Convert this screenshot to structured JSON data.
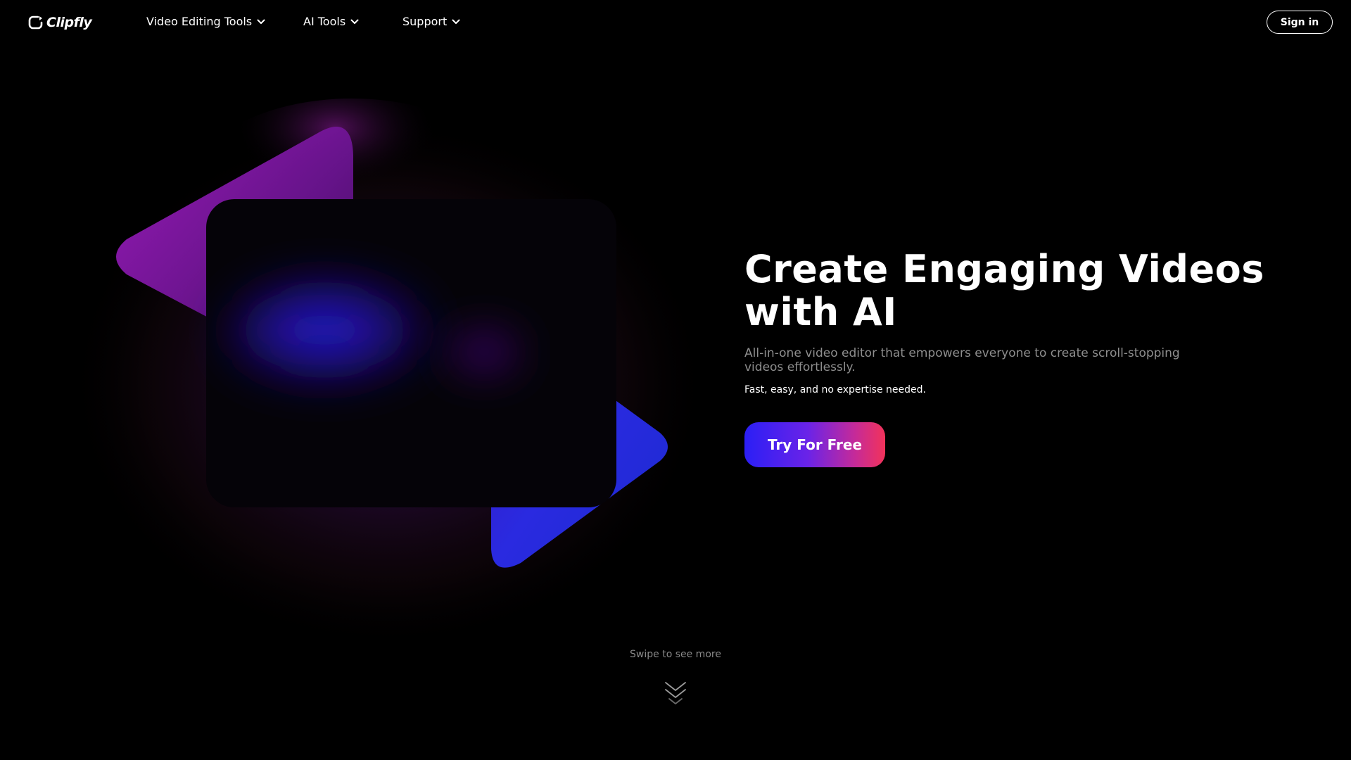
{
  "brand": {
    "logo_text": "Clipfly",
    "logo_icon": "clipfly-logo-icon"
  },
  "nav": {
    "items": [
      {
        "label": "Video Editing Tools",
        "icon": "chevron-down-icon"
      },
      {
        "label": "AI Tools",
        "icon": "chevron-down-icon"
      },
      {
        "label": "Support",
        "icon": "chevron-down-icon"
      }
    ],
    "signin_label": "Sign in"
  },
  "hero": {
    "title_line1": "Create Engaging Videos",
    "title_line2": "with AI",
    "subtitle": "All-in-one video editor that empowers everyone to create scroll-stopping videos effortlessly.",
    "note": "Fast, easy, and no expertise needed.",
    "cta_label": "Try For Free"
  },
  "scroll_hint": {
    "label": "Swipe to see more",
    "icon": "double-chevron-down-icon"
  },
  "colors": {
    "background": "#000000",
    "cta_gradient_start": "#2b1ff5",
    "cta_gradient_end": "#f2335a",
    "accent_purple": "#9b1fd0",
    "accent_blue": "#2a2ee8"
  }
}
